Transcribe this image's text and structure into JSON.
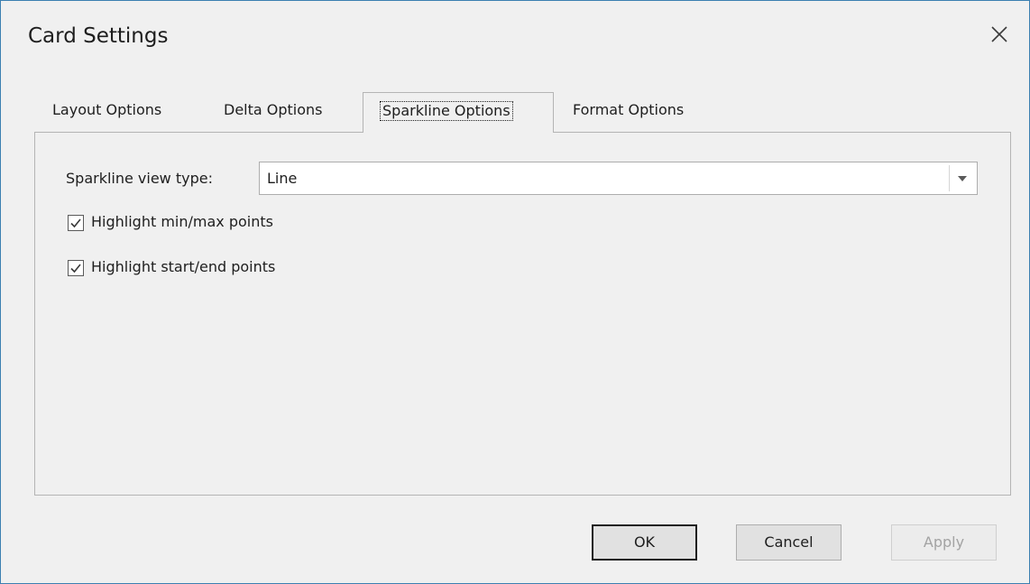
{
  "dialog": {
    "title": "Card Settings",
    "close_icon": "close-icon"
  },
  "tabs": [
    {
      "label": "Layout Options",
      "active": false
    },
    {
      "label": "Delta Options",
      "active": false
    },
    {
      "label": "Sparkline Options",
      "active": true
    },
    {
      "label": "Format Options",
      "active": false
    }
  ],
  "sparkline": {
    "view_type_label": "Sparkline view type:",
    "view_type_value": "Line",
    "highlight_minmax_label": "Highlight min/max points",
    "highlight_minmax_checked": true,
    "highlight_startend_label": "Highlight start/end points",
    "highlight_startend_checked": true
  },
  "buttons": {
    "ok": "OK",
    "cancel": "Cancel",
    "apply": "Apply",
    "apply_enabled": false
  },
  "colors": {
    "window_border": "#3c7fb1",
    "background": "#f0f0f0"
  }
}
